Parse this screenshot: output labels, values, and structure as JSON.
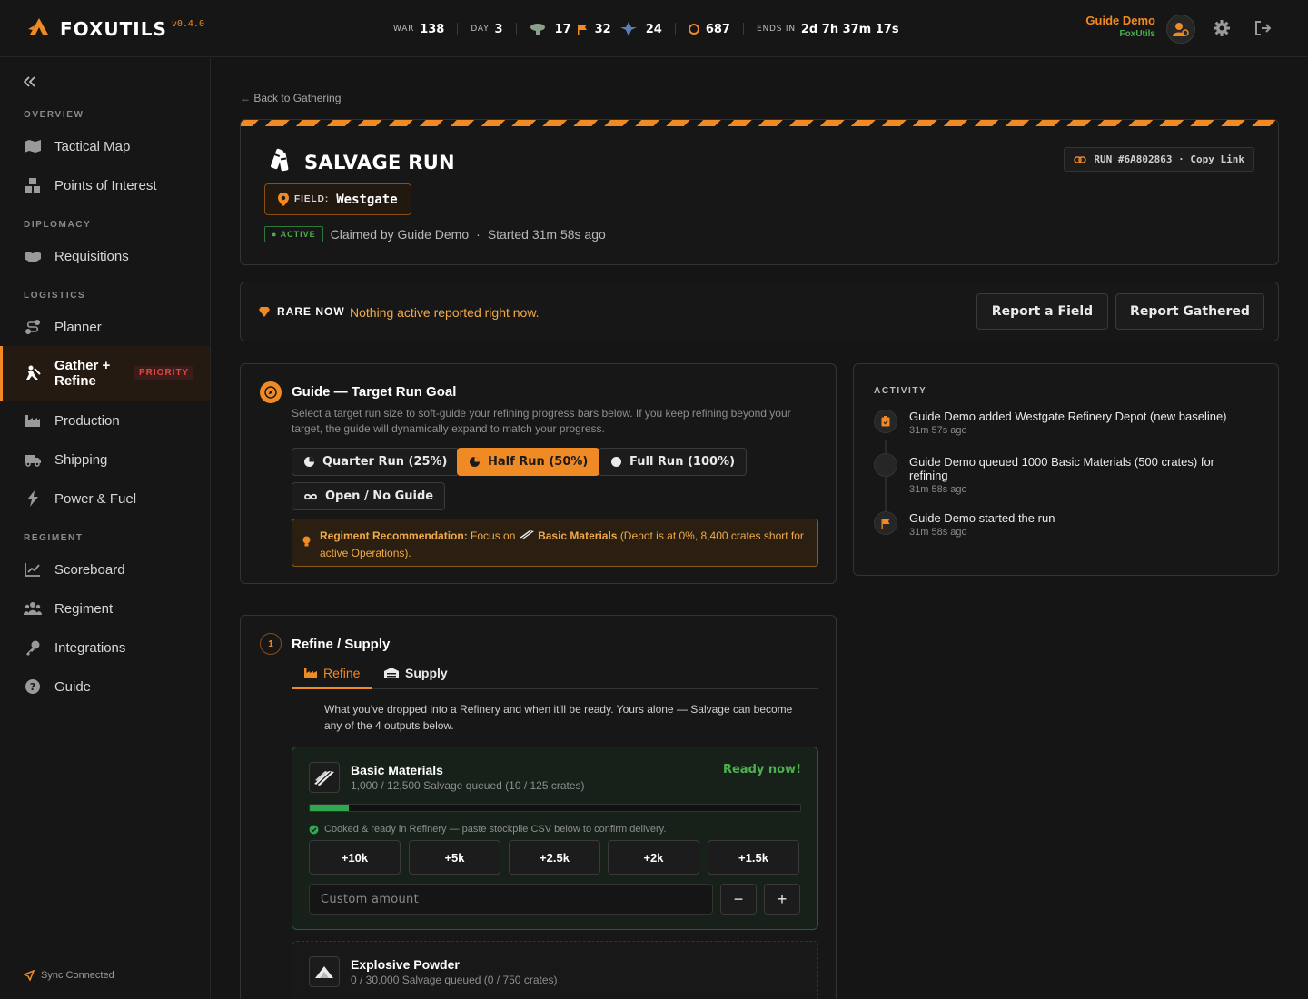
{
  "app": {
    "name": "FOXUTILS",
    "version": "v0.4.0",
    "accent": "#f08a24"
  },
  "topbar": {
    "war_label": "WAR",
    "war_value": "138",
    "day_label": "DAY",
    "day_value": "3",
    "warden_count": "17",
    "flag_count": "32",
    "colonial_count": "24",
    "coin_count": "687",
    "ends_label": "ENDS IN",
    "ends_value": "2d 7h 37m 17s",
    "user_name": "Guide Demo",
    "user_org": "FoxUtils"
  },
  "sidebar": {
    "sections": {
      "overview": "OVERVIEW",
      "diplomacy": "DIPLOMACY",
      "logistics": "LOGISTICS",
      "regiment": "REGIMENT"
    },
    "items": {
      "tactical_map": "Tactical Map",
      "poi": "Points of Interest",
      "requisitions": "Requisitions",
      "planner": "Planner",
      "gather": "Gather +",
      "gather2": "Refine",
      "priority": "PRIORITY",
      "production": "Production",
      "shipping": "Shipping",
      "power": "Power & Fuel",
      "scoreboard": "Scoreboard",
      "regiment": "Regiment",
      "integrations": "Integrations",
      "guide": "Guide"
    },
    "sync": "Sync Connected"
  },
  "main": {
    "back": "Back to Gathering",
    "run_title": "SALVAGE RUN",
    "field_label": "FIELD:",
    "field_value": "Westgate",
    "run_id": "RUN #6A802863 · Copy Link",
    "status_badge": "ACTIVE",
    "claimed": "Claimed by Guide Demo",
    "dot": "·",
    "started": "Started 31m 58s ago",
    "rare_label": "RARE NOW",
    "rare_msg": "Nothing active reported right now.",
    "report_field": "Report a Field",
    "report_gathered": "Report Gathered"
  },
  "guide": {
    "title": "Guide — Target Run Goal",
    "desc": "Select a target run size to soft-guide your refining progress bars below. If you keep refining beyond your target, the guide will dynamically expand to match your progress.",
    "quarter": "Quarter Run (25%)",
    "half": "Half Run (50%)",
    "full": "Full Run (100%)",
    "open": "Open / No Guide",
    "reco_label": "Regiment Recommendation:",
    "reco_focus": "Focus on",
    "reco_item": "Basic Materials",
    "reco_rest": "(Depot is at 0%, 8,400 crates short for active Operations)."
  },
  "activity": {
    "heading": "ACTIVITY",
    "items": [
      {
        "text": "Guide Demo added Westgate Refinery Depot (new baseline)",
        "time": "31m 57s ago"
      },
      {
        "text": "Guide Demo queued 1000 Basic Materials (500 crates) for refining",
        "time": "31m 58s ago"
      },
      {
        "text": "Guide Demo started the run",
        "time": "31m 58s ago"
      }
    ]
  },
  "refine": {
    "step": "1",
    "title": "Refine / Supply",
    "tab_refine": "Refine",
    "tab_supply": "Supply",
    "desc": "What you've dropped into a Refinery and when it'll be ready. Yours alone — Salvage can become any of the 4 outputs below.",
    "basic": {
      "name": "Basic Materials",
      "sub": "1,000 / 12,500 Salvage queued (10 / 125 crates)",
      "ready": "Ready now!",
      "progress": 0.08,
      "cooked": "Cooked & ready in Refinery — paste stockpile CSV below to confirm delivery.",
      "amounts": [
        "+10k",
        "+5k",
        "+2.5k",
        "+2k",
        "+1.5k"
      ],
      "custom_placeholder": "Custom amount",
      "minus": "−",
      "plus": "+"
    },
    "explosive": {
      "name": "Explosive Powder",
      "sub": "0 / 30,000 Salvage queued (0 / 750 crates)"
    }
  }
}
